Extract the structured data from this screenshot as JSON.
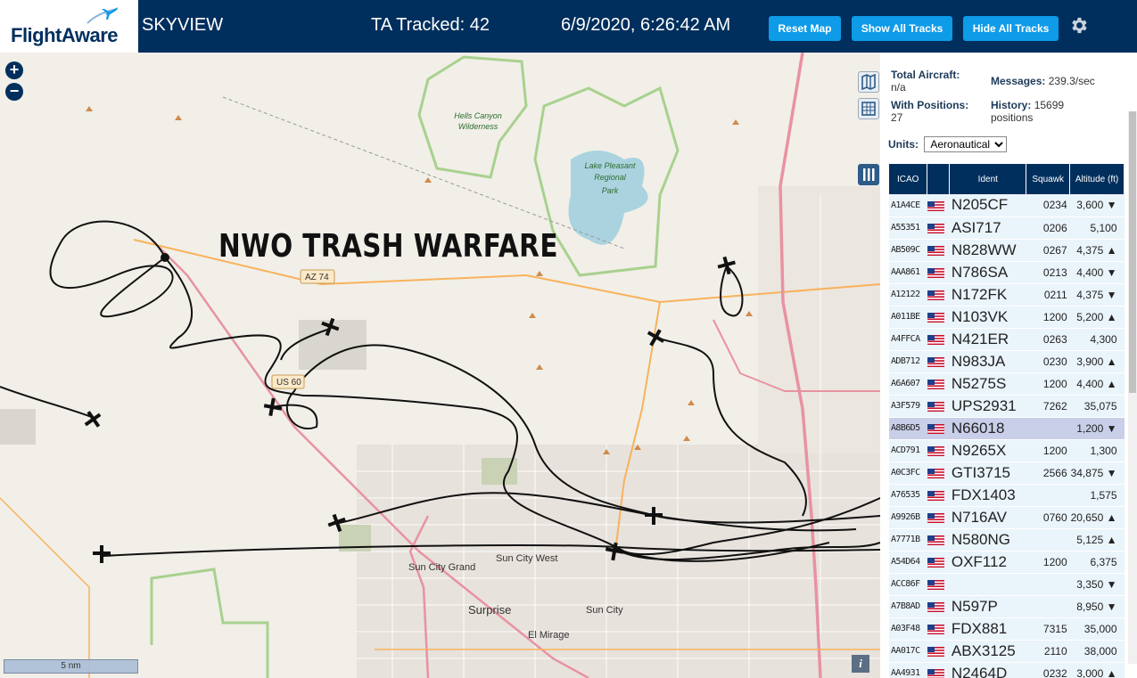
{
  "header": {
    "logo": "FlightAware",
    "app_name": "SKYVIEW",
    "tracked": "TA Tracked: 42",
    "datetime": "6/9/2020, 6:26:42 AM",
    "reset_map": "Reset Map",
    "show_all_tracks": "Show All Tracks",
    "hide_all_tracks": "Hide All Tracks",
    "settings_icon": "gear-icon"
  },
  "map": {
    "overlay_text": "NWO TRASH WARFARE",
    "zoom_in": "+",
    "zoom_out": "−",
    "scale": "5 nm",
    "info": "i",
    "labels": {
      "hells_canyon": "Hells Canyon",
      "wilderness": "Wilderness",
      "lake_pleasant_1": "Lake Pleasant",
      "lake_pleasant_2": "Regional",
      "lake_pleasant_3": "Park",
      "az74": "AZ 74",
      "us60": "US 60",
      "sun_city_grand": "Sun City Grand",
      "sun_city_west": "Sun City West",
      "sun_city": "Sun City",
      "surprise": "Surprise",
      "el_mirage": "El Mirage"
    },
    "colors": {
      "land": "#f1efe8",
      "water": "#aad3df",
      "freeway": "#e892a2",
      "highway": "#f9b25b",
      "park_border": "#a9d18e"
    }
  },
  "panel": {
    "total_aircraft_label": "Total Aircraft:",
    "total_aircraft_value": "n/a",
    "messages_label": "Messages:",
    "messages_value": "239.3/sec",
    "with_positions_label": "With Positions:",
    "with_positions_value": "27",
    "history_label": "History:",
    "history_value": "15699 positions",
    "units_label": "Units:",
    "units_value": "Aeronautical",
    "columns": [
      "ICAO",
      "Ident",
      "Squawk",
      "Altitude (ft)"
    ],
    "rows": [
      {
        "icao": "A1A4CE",
        "ident": "N205CF",
        "squawk": "0234",
        "alt": "3,600 ▼",
        "sel": false
      },
      {
        "icao": "A55351",
        "ident": "ASI717",
        "squawk": "0206",
        "alt": "5,100",
        "sel": false
      },
      {
        "icao": "AB509C",
        "ident": "N828WW",
        "squawk": "0267",
        "alt": "4,375 ▲",
        "sel": false
      },
      {
        "icao": "AAA861",
        "ident": "N786SA",
        "squawk": "0213",
        "alt": "4,400 ▼",
        "sel": false
      },
      {
        "icao": "A12122",
        "ident": "N172FK",
        "squawk": "0211",
        "alt": "4,375 ▼",
        "sel": false
      },
      {
        "icao": "A011BE",
        "ident": "N103VK",
        "squawk": "1200",
        "alt": "5,200 ▲",
        "sel": false
      },
      {
        "icao": "A4FFCA",
        "ident": "N421ER",
        "squawk": "0263",
        "alt": "4,300",
        "sel": false
      },
      {
        "icao": "ADB712",
        "ident": "N983JA",
        "squawk": "0230",
        "alt": "3,900 ▲",
        "sel": false
      },
      {
        "icao": "A6A607",
        "ident": "N5275S",
        "squawk": "1200",
        "alt": "4,400 ▲",
        "sel": false
      },
      {
        "icao": "A3F579",
        "ident": "UPS2931",
        "squawk": "7262",
        "alt": "35,075",
        "sel": false
      },
      {
        "icao": "A8B6D5",
        "ident": "N66018",
        "squawk": "",
        "alt": "1,200 ▼",
        "sel": true
      },
      {
        "icao": "ACD791",
        "ident": "N9265X",
        "squawk": "1200",
        "alt": "1,300",
        "sel": false
      },
      {
        "icao": "A0C3FC",
        "ident": "GTI3715",
        "squawk": "2566",
        "alt": "34,875 ▼",
        "sel": false
      },
      {
        "icao": "A76535",
        "ident": "FDX1403",
        "squawk": "",
        "alt": "1,575",
        "sel": false
      },
      {
        "icao": "A9926B",
        "ident": "N716AV",
        "squawk": "0760",
        "alt": "20,650 ▲",
        "sel": false
      },
      {
        "icao": "A7771B",
        "ident": "N580NG",
        "squawk": "",
        "alt": "5,125 ▲",
        "sel": false
      },
      {
        "icao": "A54D64",
        "ident": "OXF112",
        "squawk": "1200",
        "alt": "6,375",
        "sel": false
      },
      {
        "icao": "ACC86F",
        "ident": "",
        "squawk": "",
        "alt": "3,350 ▼",
        "sel": false
      },
      {
        "icao": "A7B8AD",
        "ident": "N597P",
        "squawk": "",
        "alt": "8,950 ▼",
        "sel": false
      },
      {
        "icao": "A03F48",
        "ident": "FDX881",
        "squawk": "7315",
        "alt": "35,000",
        "sel": false
      },
      {
        "icao": "AA017C",
        "ident": "ABX3125",
        "squawk": "2110",
        "alt": "38,000",
        "sel": false
      },
      {
        "icao": "AA4931",
        "ident": "N2464D",
        "squawk": "0232",
        "alt": "3,000 ▲",
        "sel": false
      }
    ]
  }
}
